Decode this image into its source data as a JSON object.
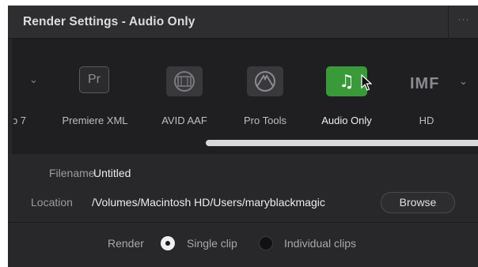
{
  "window": {
    "title": "Render Settings - Audio Only",
    "menu_glyph": "···"
  },
  "presets": {
    "partial_label": "o 7",
    "items": [
      {
        "label": "Premiere XML",
        "icon": "premiere-pr-icon",
        "icon_text": "Pr"
      },
      {
        "label": "AVID AAF",
        "icon": "film-reel-icon"
      },
      {
        "label": "Pro Tools",
        "icon": "pro-tools-icon"
      },
      {
        "label": "Audio Only",
        "icon": "music-note-icon",
        "icon_text": "♫",
        "selected": true
      },
      {
        "label": "HD",
        "icon": "imf-icon",
        "icon_text": "IMF"
      }
    ],
    "accent_color": "#3a9a3a"
  },
  "fields": {
    "filename_label": "Filename",
    "filename_value": "Untitled",
    "location_label": "Location",
    "location_value": "/Volumes/Macintosh HD/Users/maryblackmagic",
    "browse_label": "Browse"
  },
  "render": {
    "label": "Render",
    "options": [
      {
        "label": "Single clip",
        "selected": true
      },
      {
        "label": "Individual clips",
        "selected": false
      }
    ]
  }
}
